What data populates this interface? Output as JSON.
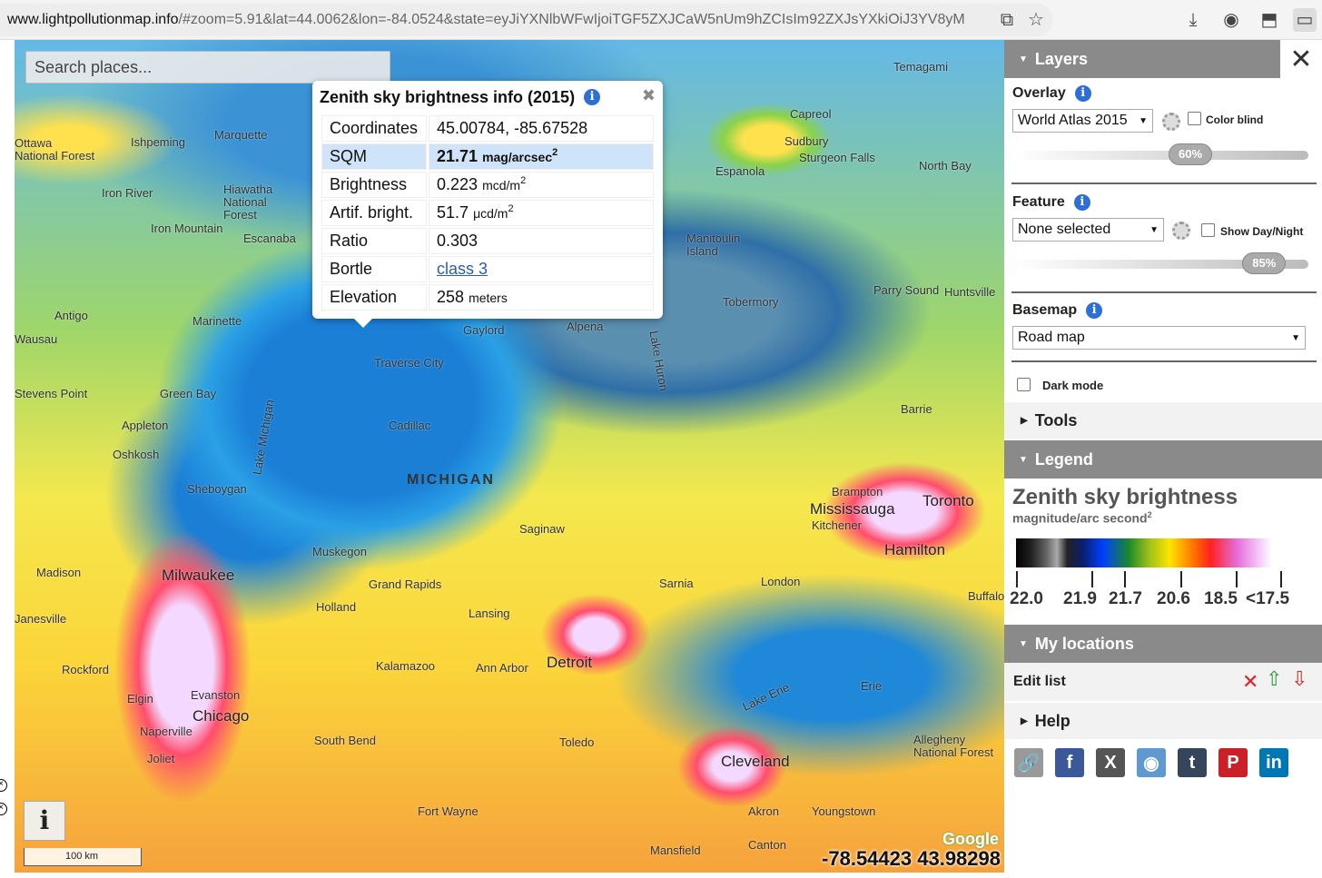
{
  "browser": {
    "url_domain": "www.lightpollutionmap.info",
    "url_rest": "/#zoom=5.91&lat=44.0062&lon=-84.0524&state=eyJiYXNlbWFwIjoiTGF5ZXJCaW5nUm9hZCIsIm92ZXJsYXkiOiJ3YV8yM"
  },
  "map": {
    "search_placeholder": "Search places...",
    "state_label": "MICHIGAN",
    "cities": [
      "Milwaukee",
      "Chicago",
      "Detroit",
      "Toronto",
      "Mississauga",
      "Hamilton",
      "Cleveland",
      "Grand Rapids",
      "Lansing",
      "Kalamazoo",
      "Ann Arbor",
      "Toledo",
      "Green Bay",
      "Marquette",
      "Sudbury",
      "Barrie",
      "London",
      "Sarnia",
      "Fort Wayne",
      "Akron",
      "South Bend",
      "Muskegon",
      "Traverse City",
      "Cadillac",
      "Saginaw",
      "Appleton",
      "Oshkosh",
      "Sheboygan",
      "Madison",
      "Rockford",
      "Joliet",
      "Naperville",
      "Elgin",
      "Evanston",
      "Holland",
      "Kitchener",
      "Brampton",
      "Erie",
      "Youngstown",
      "Mansfield",
      "Canton",
      "Iron Mountain",
      "Escanaba",
      "Ishpeming",
      "Iron River",
      "Antigo",
      "Marinette",
      "Gaylord",
      "Alpena",
      "Tobermory",
      "Parry Sound",
      "Huntsville",
      "Espanola",
      "North Bay",
      "Sturgeon Falls",
      "Capreol",
      "Temagami",
      "Stevens Point",
      "Wausau",
      "Janesville",
      "Buffalo",
      "Allegheny National Forest",
      "Hiawatha National Forest",
      "Ottawa National Forest",
      "Lake Erie",
      "Lake Huron",
      "Lake Michigan",
      "Manitoulin Island"
    ],
    "info_button": "i",
    "scale_label": "100 km",
    "cursor_coords": "-78.54423 43.98298",
    "google_logo": "Google"
  },
  "popup": {
    "title": "Zenith sky brightness info (2015)",
    "rows": [
      {
        "label": "Coordinates",
        "value": "45.00784, -85.67528",
        "unit": ""
      },
      {
        "label": "SQM",
        "value": "21.71",
        "unit": "mag/arcsec",
        "sup": "2"
      },
      {
        "label": "Brightness",
        "value": "0.223",
        "unit": "mcd/m",
        "sup": "2"
      },
      {
        "label": "Artif. bright.",
        "value": "51.7",
        "unit": "μcd/m",
        "sup": "2"
      },
      {
        "label": "Ratio",
        "value": "0.303",
        "unit": ""
      },
      {
        "label": "Bortle",
        "value": "class 3",
        "unit": ""
      },
      {
        "label": "Elevation",
        "value": "258",
        "unit": "meters"
      }
    ]
  },
  "panel": {
    "layers_header": "Layers",
    "overlay_label": "Overlay",
    "overlay_value": "World Atlas 2015",
    "colorblind_label": "Color blind",
    "overlay_opacity": "60%",
    "overlay_opacity_value": 0.6,
    "feature_label": "Feature",
    "feature_value": "None selected",
    "daynight_label": "Show Day/Night",
    "feature_opacity": "85%",
    "feature_opacity_value": 0.85,
    "basemap_label": "Basemap",
    "basemap_value": "Road map",
    "darkmode_label": "Dark mode",
    "tools_header": "Tools",
    "legend_header": "Legend",
    "legend_title": "Zenith sky brightness",
    "legend_sub": "magnitude/arc second",
    "legend_sub_sup": "2",
    "legend_ticks": [
      "22.0",
      "21.9",
      "21.7",
      "20.6",
      "18.5",
      "<17.5"
    ],
    "mylocations_header": "My locations",
    "edit_list": "Edit list",
    "help_header": "Help"
  },
  "colors": {
    "panel_header": "#8a8a8a",
    "facebook": "#3b5998",
    "x": "#555555",
    "reddit": "#5f99cf",
    "tumblr": "#35465c",
    "pinterest": "#cb2027",
    "linkedin": "#0077b5"
  }
}
